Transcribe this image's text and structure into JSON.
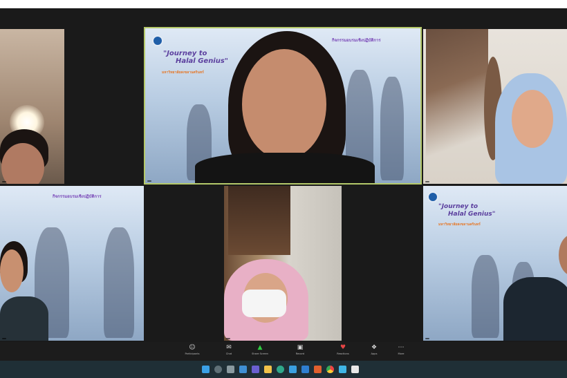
{
  "poster": {
    "title_line1": "\"Journey to",
    "title_line2": "Halal Genius\"",
    "subtitle": "มหาวิทยาลัยสงขลานครินทร์",
    "headline": "กิจกรรมอบรมเชิงปฏิบัติการ"
  },
  "participants": [
    {
      "name": ""
    },
    {
      "name": ""
    },
    {
      "name": ""
    },
    {
      "name": ""
    },
    {
      "name": ""
    },
    {
      "name": ""
    }
  ],
  "toolbar": {
    "participants": "Participants",
    "chat": "Chat",
    "share_screen": "Share Screen",
    "record": "Record",
    "reactions": "Reactions",
    "apps": "Apps",
    "more": "More"
  },
  "colors": {
    "active_speaker_border": "#b5c96a",
    "meeting_bg": "#1a1a1a",
    "taskbar_bg": "#1f2f36",
    "share_green": "#2ecc40"
  }
}
